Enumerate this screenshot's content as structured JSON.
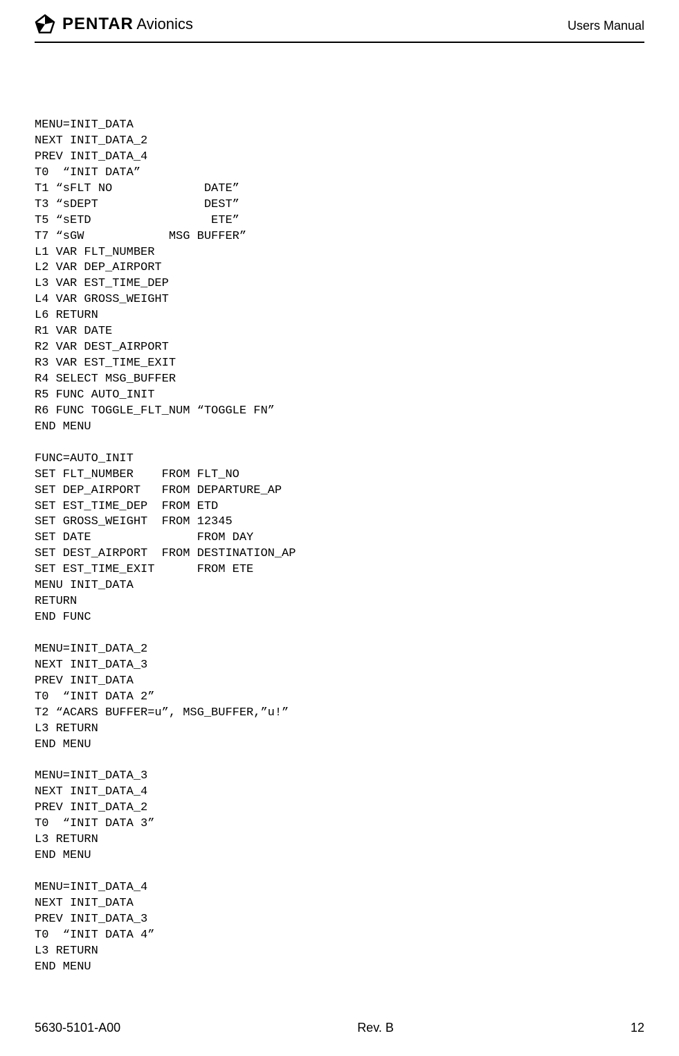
{
  "header": {
    "company": "PENTAR",
    "product": "Avionics",
    "manual_type": "Users Manual"
  },
  "code_lines": [
    "MENU=INIT_DATA",
    "NEXT INIT_DATA_2",
    "PREV INIT_DATA_4",
    "T0  “INIT DATA”",
    "T1 “sFLT NO             DATE”",
    "T3 “sDEPT               DEST”",
    "T5 “sETD                 ETE”",
    "T7 “sGW            MSG BUFFER”",
    "L1 VAR FLT_NUMBER",
    "L2 VAR DEP_AIRPORT",
    "L3 VAR EST_TIME_DEP",
    "L4 VAR GROSS_WEIGHT",
    "L6 RETURN",
    "R1 VAR DATE",
    "R2 VAR DEST_AIRPORT",
    "R3 VAR EST_TIME_EXIT",
    "R4 SELECT MSG_BUFFER",
    "R5 FUNC AUTO_INIT",
    "R6 FUNC TOGGLE_FLT_NUM “TOGGLE FN”",
    "END MENU",
    "",
    "FUNC=AUTO_INIT",
    "SET FLT_NUMBER    FROM FLT_NO",
    "SET DEP_AIRPORT   FROM DEPARTURE_AP",
    "SET EST_TIME_DEP  FROM ETD",
    "SET GROSS_WEIGHT  FROM 12345",
    "SET DATE               FROM DAY",
    "SET DEST_AIRPORT  FROM DESTINATION_AP",
    "SET EST_TIME_EXIT      FROM ETE",
    "MENU INIT_DATA",
    "RETURN",
    "END FUNC",
    "",
    "MENU=INIT_DATA_2",
    "NEXT INIT_DATA_3",
    "PREV INIT_DATA",
    "T0  “INIT DATA 2”",
    "T2 “ACARS BUFFER=u”, MSG_BUFFER,”u!”",
    "L3 RETURN",
    "END MENU",
    "",
    "MENU=INIT_DATA_3",
    "NEXT INIT_DATA_4",
    "PREV INIT_DATA_2",
    "T0  “INIT DATA 3”",
    "L3 RETURN",
    "END MENU",
    "",
    "MENU=INIT_DATA_4",
    "NEXT INIT_DATA",
    "PREV INIT_DATA_3",
    "T0  “INIT DATA 4”",
    "L3 RETURN",
    "END MENU"
  ],
  "footer": {
    "doc_number": "5630-5101-A00",
    "revision": "Rev. B",
    "page_number": "12"
  }
}
